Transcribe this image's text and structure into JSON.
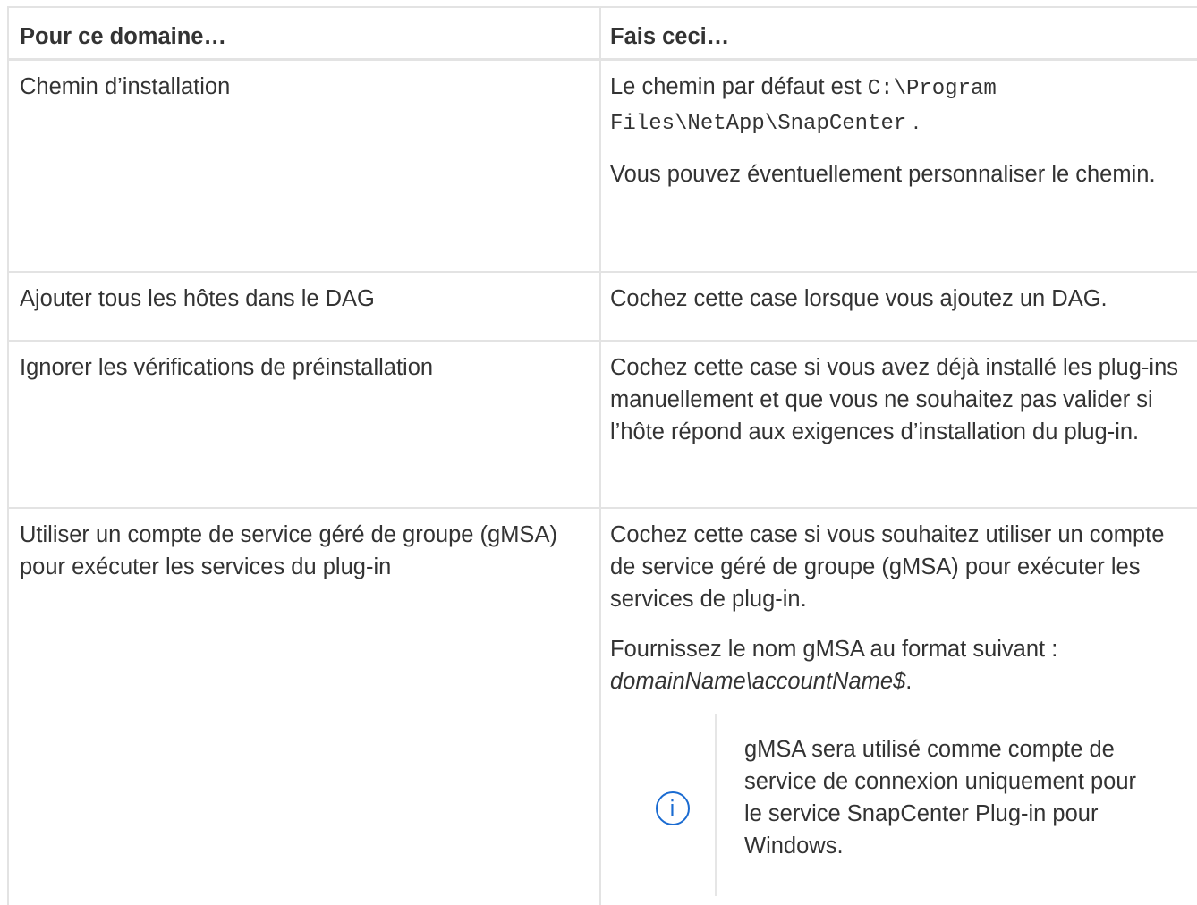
{
  "table": {
    "headers": [
      "Pour ce domaine…",
      "Fais ceci…"
    ],
    "rows": [
      {
        "field": "Chemin d’installation",
        "desc_prefix": "Le chemin par défaut est ",
        "desc_code_line1": "C:\\Program",
        "desc_code_line2": "Files\\NetApp\\SnapCenter",
        "desc_suffix": ".",
        "desc_para2": "Vous pouvez éventuellement personnaliser le chemin."
      },
      {
        "field": "Ajouter tous les hôtes dans le DAG",
        "desc": "Cochez cette case lorsque vous ajoutez un DAG."
      },
      {
        "field": "Ignorer les vérifications de préinstallation",
        "desc": "Cochez cette case si vous avez déjà installé les plug-ins manuellement et que vous ne souhaitez pas valider si l’hôte répond aux exigences d’installation du plug-in."
      },
      {
        "field": "Utiliser un compte de service géré de groupe (gMSA) pour exécuter les services du plug-in",
        "desc": "Cochez cette case si vous souhaitez utiliser un compte de service géré de groupe (gMSA) pour exécuter les services de plug-in.",
        "desc_para2_prefix": "Fournissez le nom gMSA au format suivant :",
        "desc_para2_format": "domainName\\accountName$",
        "desc_para2_suffix": ".",
        "note_icon": "info-icon",
        "note": "gMSA sera utilisé comme compte de service de connexion uniquement pour le service SnapCenter Plug-in pour Windows."
      }
    ]
  },
  "colors": {
    "text": "#333333",
    "border": "#e3e3e3",
    "icon": "#1a6bd1"
  }
}
